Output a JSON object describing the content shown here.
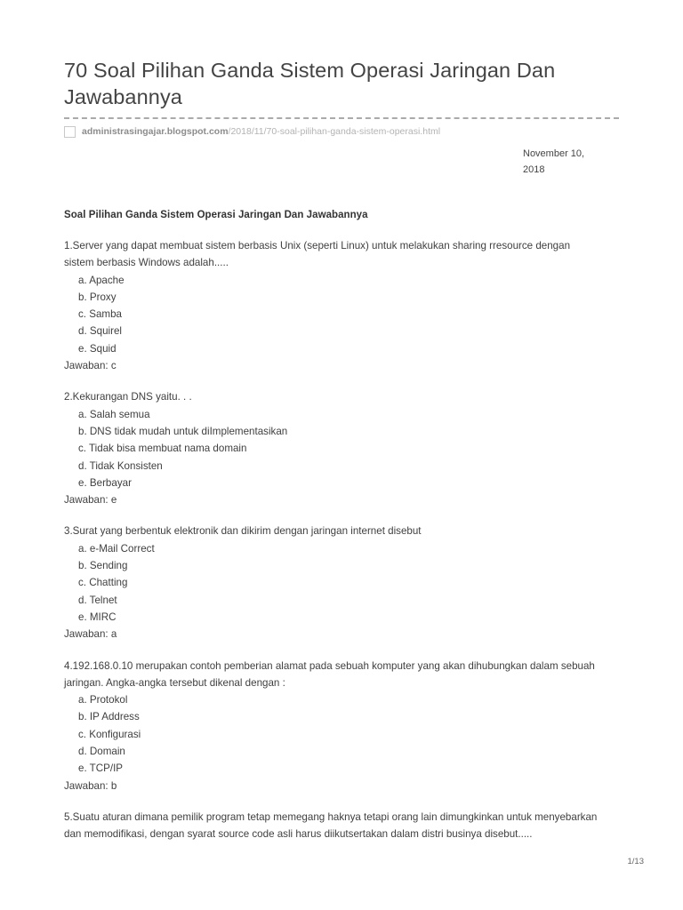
{
  "document": {
    "title": "70 Soal Pilihan Ganda Sistem Operasi Jaringan Dan Jawabannya",
    "source": {
      "favicon": "empty-square-icon",
      "domain": "administrasingajar.blogspot.com",
      "path": "/2018/11/70-soal-pilihan-ganda-sistem-operasi.html"
    },
    "date_line_1": "November 10,",
    "date_line_2": "2018",
    "page_indicator": "1/13",
    "section_heading": "Soal Pilihan Ganda Sistem Operasi Jaringan Dan Jawabannya",
    "questions": [
      {
        "text": "1.Server yang dapat membuat sistem berbasis Unix (seperti Linux) untuk melakukan sharing rresource dengan sistem berbasis Windows adalah.....",
        "options": [
          "a. Apache",
          "b. Proxy",
          "c. Samba",
          "d. Squirel",
          "e. Squid"
        ],
        "answer": "Jawaban: c"
      },
      {
        "text": "2.Kekurangan DNS yaitu. . .",
        "options": [
          "a. Salah semua",
          "b. DNS tidak mudah untuk diImplementasikan",
          "c. Tidak bisa membuat nama domain",
          "d. Tidak Konsisten",
          "e. Berbayar"
        ],
        "answer": "Jawaban: e"
      },
      {
        "text": "3.Surat yang berbentuk elektronik dan dikirim dengan jaringan internet disebut",
        "options": [
          "a. e-Mail Correct",
          "b. Sending",
          "c. Chatting",
          "d. Telnet",
          "e. MIRC"
        ],
        "answer": "Jawaban: a"
      },
      {
        "text": "4.192.168.0.10 merupakan contoh pemberian alamat pada sebuah komputer yang akan dihubungkan dalam sebuah jaringan. Angka-angka tersebut dikenal dengan :",
        "options": [
          "a. Protokol",
          "b. IP Address",
          "c. Konfigurasi",
          "d. Domain",
          "e. TCP/IP"
        ],
        "answer": "Jawaban: b"
      },
      {
        "text": "5.Suatu aturan dimana pemilik program tetap memegang haknya tetapi orang lain dimungkinkan untuk menyebarkan dan memodifikasi, dengan syarat source code asli harus diikutsertakan dalam distri businya disebut.....",
        "options": [],
        "answer": ""
      }
    ]
  }
}
